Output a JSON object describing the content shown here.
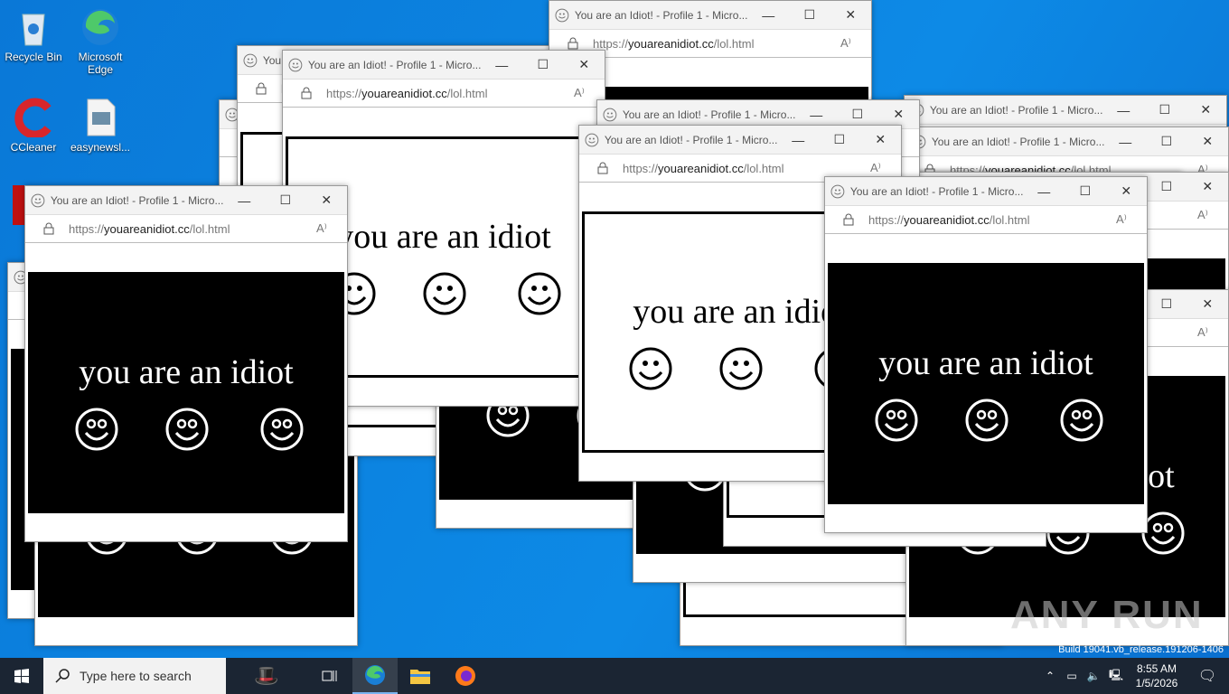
{
  "desktop": {
    "icons": [
      {
        "label": "Recycle Bin"
      },
      {
        "label": "Microsoft Edge"
      },
      {
        "label": "CCleaner"
      },
      {
        "label": "easynewsl..."
      }
    ]
  },
  "browser_window": {
    "title": "You are an Idiot! - Profile 1 - Micro...",
    "url_prefix": "https://",
    "url_domain": "youareanidiot.cc",
    "url_path": "/lol.html",
    "headline": "you are an idiot",
    "minimize": "—",
    "maximize": "☐",
    "close": "✕",
    "read_aloud": "A⁾"
  },
  "windows": [
    {
      "theme": "dark"
    },
    {
      "theme": "dark"
    },
    {
      "theme": "light"
    },
    {
      "theme": "light"
    },
    {
      "theme": "dark"
    },
    {
      "theme": "light"
    },
    {
      "theme": "light"
    },
    {
      "theme": "light"
    },
    {
      "theme": "dark"
    },
    {
      "theme": "light"
    },
    {
      "theme": "dark"
    },
    {
      "theme": "dark"
    },
    {
      "theme": "dark"
    },
    {
      "theme": "light"
    },
    {
      "theme": "light"
    },
    {
      "theme": "light"
    },
    {
      "theme": "light"
    },
    {
      "theme": "dark"
    },
    {
      "theme": "dark"
    }
  ],
  "taskbar": {
    "search_placeholder": "Type here to search",
    "time": "8:55 AM",
    "date": "1/5/2026"
  },
  "watermark": {
    "build": "Build 19041.vb_release.191206-1406",
    "logo": "ANY RUN"
  }
}
